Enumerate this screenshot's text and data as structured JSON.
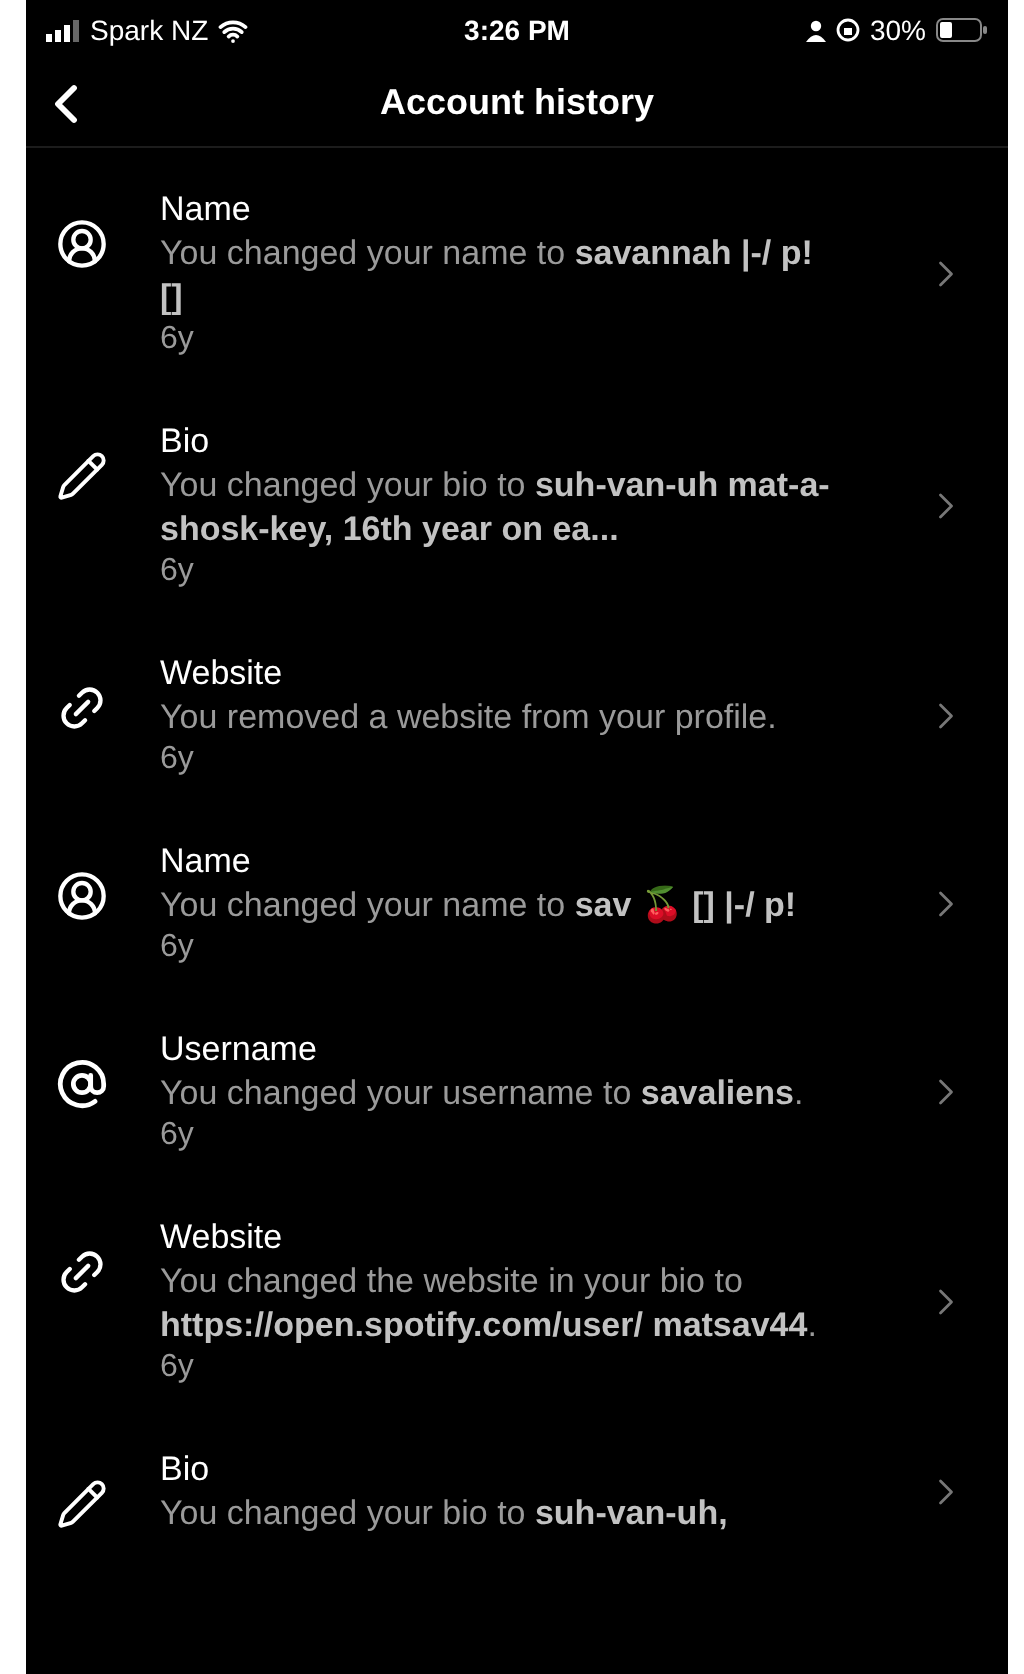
{
  "status_bar": {
    "carrier": "Spark NZ",
    "time": "3:26 PM",
    "battery": "30%"
  },
  "header": {
    "title": "Account history"
  },
  "items": [
    {
      "kind": "name",
      "title": "Name",
      "description": "You changed your name to **savannah |-/ p! []**",
      "time": "6y"
    },
    {
      "kind": "bio",
      "title": "Bio",
      "description": "You changed your bio to **suh-van-uh mat-a-shosk-key, 16th year on ea...**",
      "time": "6y"
    },
    {
      "kind": "website",
      "title": "Website",
      "description": "You removed a website from your profile.",
      "time": "6y"
    },
    {
      "kind": "name",
      "title": "Name",
      "description": "You changed your name to **sav 🍒 [] |-/ p!**",
      "time": "6y"
    },
    {
      "kind": "username",
      "title": "Username",
      "description": "You changed your username to **savaliens**.",
      "time": "6y"
    },
    {
      "kind": "website",
      "title": "Website",
      "description": "You changed the website in your bio to **https://open.spotify.com/user/ matsav44**.",
      "time": "6y"
    },
    {
      "kind": "bio",
      "title": "Bio",
      "description": "You changed your bio to **suh-van-uh,**"
    }
  ]
}
